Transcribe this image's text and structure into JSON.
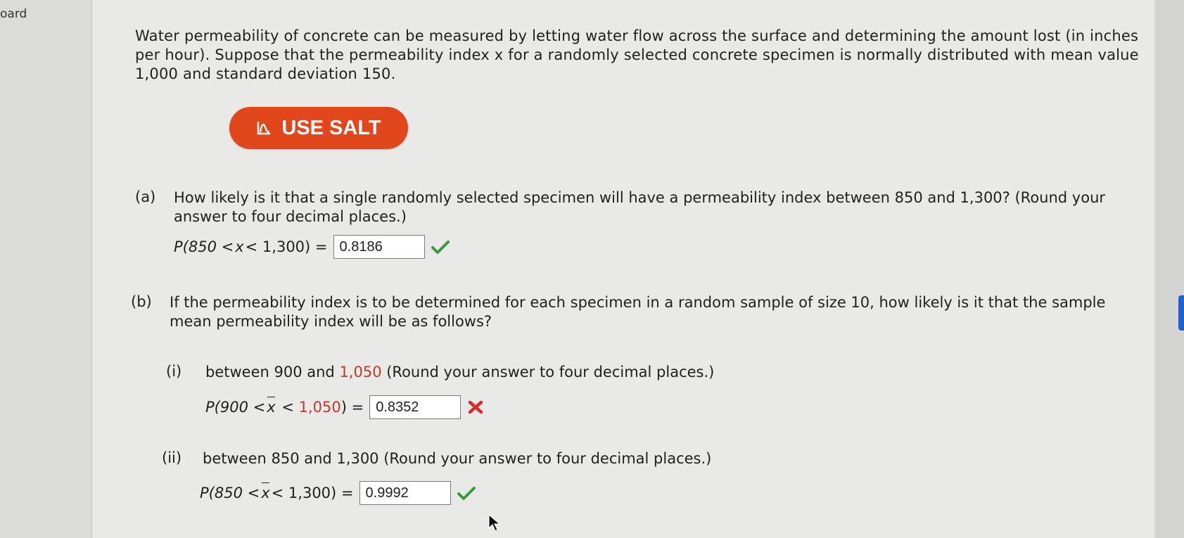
{
  "left_strip": {
    "label": "oard"
  },
  "intro": "Water permeability of concrete can be measured by letting water flow across the surface and determining the amount lost (in inches per hour). Suppose that the permeability index x for a randomly selected concrete specimen is normally distributed with mean value 1,000 and standard deviation 150.",
  "salt_button": {
    "label": "USE SALT",
    "icon": "salt-chart-icon",
    "color": "#e2471b"
  },
  "part_a": {
    "letter": "(a)",
    "text": "How likely is it that a single randomly selected specimen will have a permeability index between 850 and 1,300? (Round your answer to four decimal places.)",
    "eq_prefix": "P(850 < ",
    "eq_var": "x",
    "eq_suffix": " < 1,300) =",
    "answer": "0.8186",
    "status": "correct"
  },
  "part_b": {
    "letter": "(b)",
    "text": "If the permeability index is to be determined for each specimen in a random sample of size 10, how likely is it that the sample mean permeability index will be as follows?",
    "sub_i": {
      "label": "(i)",
      "text_pre": "between 900 and ",
      "text_highlight": "1,050",
      "text_post": " (Round your answer to four decimal places.)",
      "eq_prefix": "P(900 < ",
      "eq_var": "x",
      "eq_mid": " < ",
      "eq_highlight": "1,050",
      "eq_suffix": ") =",
      "answer": "0.8352",
      "status": "incorrect"
    },
    "sub_ii": {
      "label": "(ii)",
      "text": "between 850 and 1,300 (Round your answer to four decimal places.)",
      "eq_prefix": "P(850 < ",
      "eq_var": "x",
      "eq_suffix": " < 1,300) =",
      "answer": "0.9992",
      "status": "correct"
    }
  },
  "colors": {
    "correct": "#3a9a3a",
    "incorrect": "#d62c2c",
    "highlight": "#c0392b"
  }
}
